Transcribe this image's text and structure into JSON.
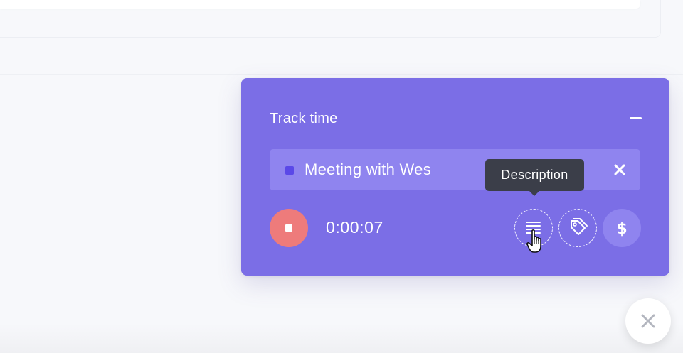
{
  "tracker": {
    "title": "Track time",
    "task": {
      "name": "Meeting with Wes",
      "color": "#5a48e8"
    },
    "timer": "0:00:07",
    "tooltip": "Description",
    "colors": {
      "card": "#7b6ee6",
      "stop_button": "#ee7b7b",
      "tooltip_bg": "#3b3e49"
    },
    "icons": {
      "minimize": "minus-icon",
      "remove_task": "close-icon",
      "stop": "stop-icon",
      "description": "description-lines-icon",
      "tags": "tag-icon",
      "billable": "dollar-icon",
      "cursor": "hand-pointer-icon"
    }
  },
  "fab": {
    "icon": "close-icon"
  }
}
